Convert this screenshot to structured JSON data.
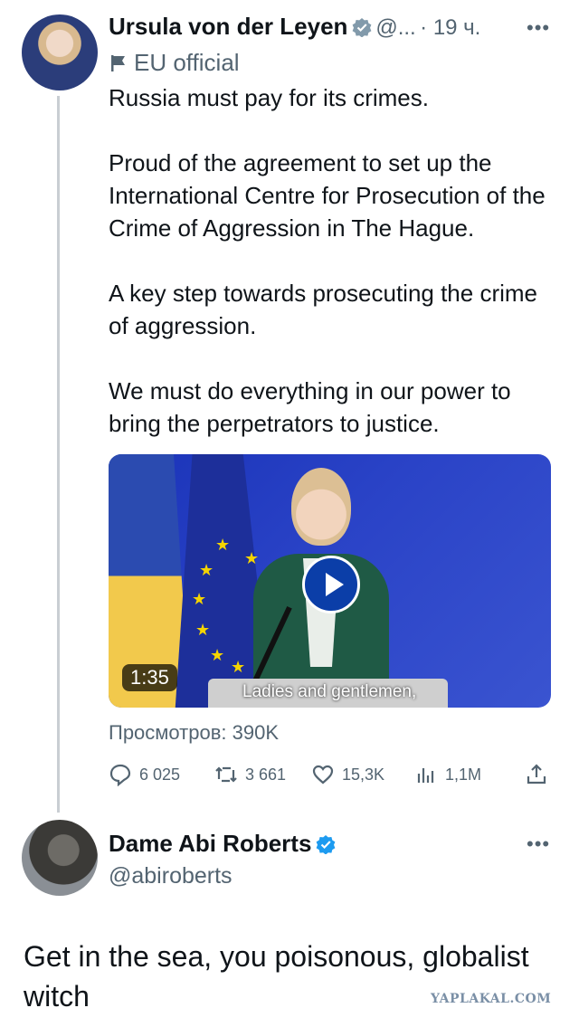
{
  "tweet": {
    "author_name": "Ursula von der Leyen",
    "handle": "@...",
    "time": "· 19 ч.",
    "label": "EU official",
    "paragraphs": [
      "Russia must pay for its crimes.",
      "Proud of the agreement to set up the International Centre for Prosecution of the Crime of Aggression in The Hague.",
      "A key step towards prosecuting the crime of aggression.",
      "We must do everything in our power to bring the perpetrators to justice."
    ],
    "video": {
      "duration": "1:35",
      "subtitle": "Ladies and gentlemen,"
    },
    "views": "Просмотров: 390K",
    "stats": {
      "replies": "6 025",
      "retweets": "3 661",
      "likes": "15,3K",
      "views": "1,1M"
    }
  },
  "reply": {
    "author_name": "Dame Abi Roberts",
    "handle": "@abiroberts",
    "text": "Get in the sea, you poisonous, globalist witch"
  },
  "more_label": "•••",
  "watermark": "YAPLAKAL.COM",
  "colors": {
    "verified": "#829aab",
    "accent": "#1d9bf0"
  }
}
